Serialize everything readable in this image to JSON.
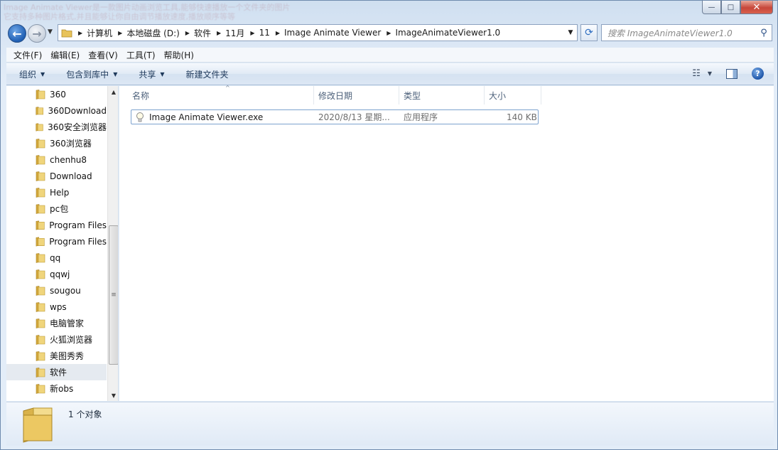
{
  "title_ghost_lines": [
    "Image Animate Viewer是一款图片动画浏览工具,能够快速播放一个文件夹的图片",
    "它支持多种图片格式,并且能够让你自由调节播放速度,播放顺序等等"
  ],
  "window_buttons": {
    "minimize": "—",
    "maximize": "□",
    "close": "✕"
  },
  "nav": {
    "breadcrumbs": [
      "计算机",
      "本地磁盘 (D:)",
      "软件",
      "11月",
      "11",
      "Image Animate Viewer",
      "ImageAnimateViewer1.0"
    ],
    "search_placeholder": "搜索 ImageAnimateViewer1.0"
  },
  "menu": [
    "文件(F)",
    "编辑(E)",
    "查看(V)",
    "工具(T)",
    "帮助(H)"
  ],
  "commands": [
    {
      "label": "组织",
      "has_dropdown": true
    },
    {
      "label": "包含到库中",
      "has_dropdown": true
    },
    {
      "label": "共享",
      "has_dropdown": true
    },
    {
      "label": "新建文件夹",
      "has_dropdown": false
    }
  ],
  "tree": [
    {
      "label": "360",
      "selected": false
    },
    {
      "label": "360Download",
      "selected": false
    },
    {
      "label": "360安全浏览器",
      "selected": false
    },
    {
      "label": "360浏览器",
      "selected": false
    },
    {
      "label": "chenhu8",
      "selected": false
    },
    {
      "label": "Download",
      "selected": false
    },
    {
      "label": "Help",
      "selected": false
    },
    {
      "label": "pc包",
      "selected": false
    },
    {
      "label": "Program Files",
      "selected": false
    },
    {
      "label": "Program Files",
      "selected": false
    },
    {
      "label": "qq",
      "selected": false
    },
    {
      "label": "qqwj",
      "selected": false
    },
    {
      "label": "sougou",
      "selected": false
    },
    {
      "label": "wps",
      "selected": false
    },
    {
      "label": "电脑管家",
      "selected": false
    },
    {
      "label": "火狐浏览器",
      "selected": false
    },
    {
      "label": "美图秀秀",
      "selected": false
    },
    {
      "label": "软件",
      "selected": true
    },
    {
      "label": "新obs",
      "selected": false
    }
  ],
  "columns": [
    "名称",
    "修改日期",
    "类型",
    "大小"
  ],
  "files": [
    {
      "name": "Image Animate Viewer.exe",
      "modified": "2020/8/13 星期...",
      "type": "应用程序",
      "size": "140 KB"
    }
  ],
  "status": {
    "item_count": "1 个对象"
  },
  "colors": {
    "accent": "#1f5fb4",
    "folder": "#e8c35a",
    "selection": "#7da2ce"
  }
}
